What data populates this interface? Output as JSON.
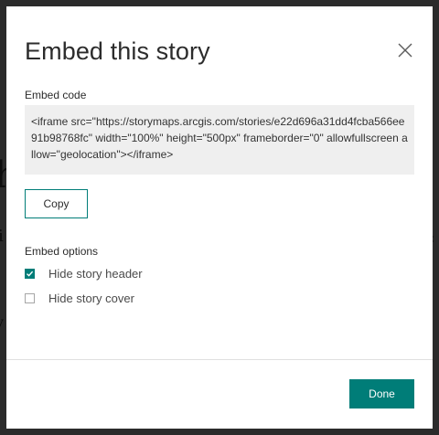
{
  "dialog": {
    "title": "Embed this story",
    "embed_code_label": "Embed code",
    "embed_code": "<iframe src=\"https://storymaps.arcgis.com/stories/e22d696a31dd4fcba566ee91b98768fc\" width=\"100%\" height=\"500px\" frameborder=\"0\" allowfullscreen allow=\"geolocation\"></iframe>",
    "copy_label": "Copy",
    "embed_options_label": "Embed options",
    "options": [
      {
        "label": "Hide story header",
        "checked": true
      },
      {
        "label": "Hide story cover",
        "checked": false
      }
    ],
    "done_label": "Done",
    "close_icon": "close-icon",
    "check_icon": "checkmark-icon"
  },
  "colors": {
    "accent": "#007d78",
    "backdrop": "#2b2b2b",
    "code_background": "#efefef",
    "title_text": "#2c2c2c"
  }
}
